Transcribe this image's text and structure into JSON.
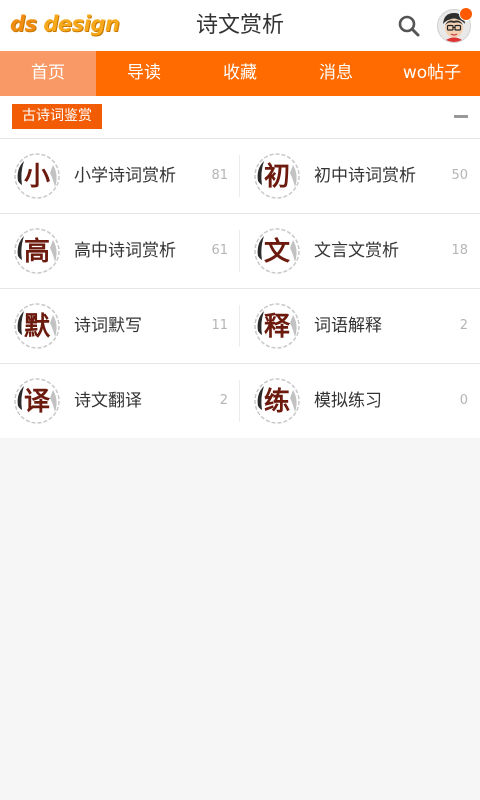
{
  "header": {
    "logo_prefix": "ds",
    "logo_text": " design",
    "title": "诗文赏析",
    "search_icon": "search-icon",
    "avatar_icon": "avatar-icon",
    "colors": {
      "accent": "#ff6b00",
      "nav_active": "#f99a66",
      "notification": "#ff5a00"
    }
  },
  "nav": {
    "tabs": [
      {
        "label": "首页",
        "active": true
      },
      {
        "label": "导读",
        "active": false
      },
      {
        "label": "收藏",
        "active": false
      },
      {
        "label": "消息",
        "active": false
      },
      {
        "label": "wo帖子",
        "active": false
      }
    ]
  },
  "section": {
    "title": "古诗词鉴赏",
    "collapse_icon": "minus-icon"
  },
  "items": [
    {
      "char": "小",
      "label": "小学诗词赏析",
      "count": "81"
    },
    {
      "char": "初",
      "label": "初中诗词赏析",
      "count": "50"
    },
    {
      "char": "高",
      "label": "高中诗词赏析",
      "count": "61"
    },
    {
      "char": "文",
      "label": "文言文赏析",
      "count": "18"
    },
    {
      "char": "默",
      "label": "诗词默写",
      "count": "11"
    },
    {
      "char": "释",
      "label": "词语解释",
      "count": "2"
    },
    {
      "char": "译",
      "label": "诗文翻译",
      "count": "2"
    },
    {
      "char": "练",
      "label": "模拟练习",
      "count": "0"
    }
  ]
}
